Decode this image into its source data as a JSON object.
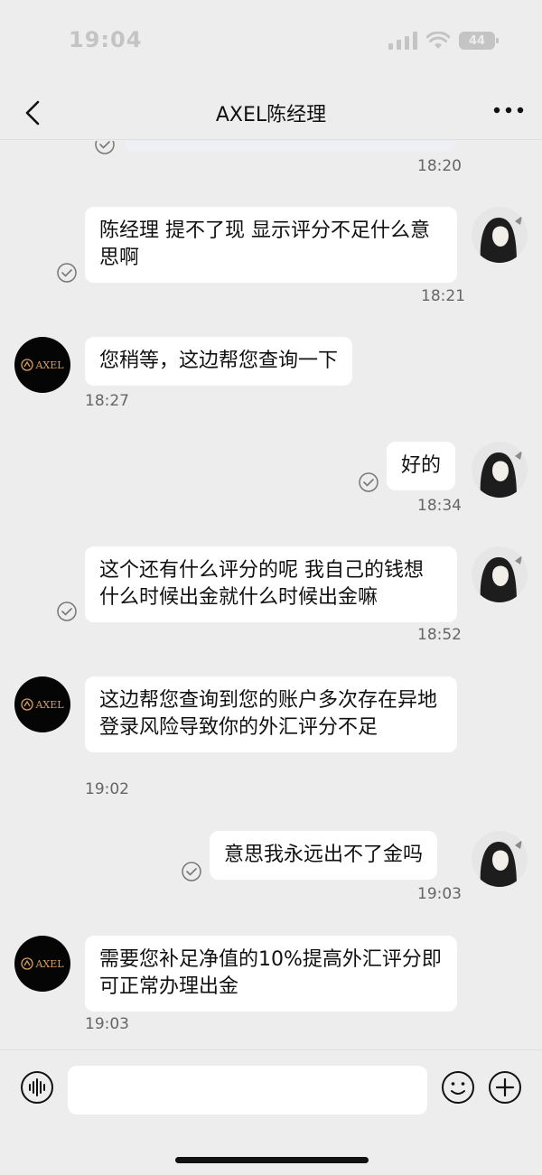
{
  "status_bar": {
    "time": "19:04",
    "battery": "44"
  },
  "header": {
    "title": "AXEL陈经理"
  },
  "avatars": {
    "agent_logo_text": "AXEL"
  },
  "messages": [
    {
      "time": "18:20"
    },
    {
      "text": "陈经理  提不了现  显示评分不足什么意思啊",
      "time": "18:21"
    },
    {
      "text": "您稍等，这边帮您查询一下",
      "time": "18:27"
    },
    {
      "text": "好的",
      "time": "18:34"
    },
    {
      "text": "这个还有什么评分的呢  我自己的钱想什么时候出金就什么时候出金嘛",
      "time": "18:52"
    },
    {
      "text": "这边帮您查询到您的账户多次存在异地登录风险导致你的外汇评分不足",
      "time": "19:02"
    },
    {
      "text": "意思我永远出不了金吗",
      "time": "19:03"
    },
    {
      "text": "需要您补足净值的10%提高外汇评分即可正常办理出金",
      "time": "19:03"
    }
  ],
  "input": {
    "value": ""
  },
  "colors": {
    "background": "#ededed",
    "bubble": "#ffffff",
    "agent_avatar_bg": "#050505",
    "logo_gold": "#d9a05a"
  },
  "icons": [
    "back-chevron-icon",
    "more-dots-icon",
    "read-check-icon",
    "voice-icon",
    "emoji-icon",
    "plus-icon",
    "signal-icon",
    "wifi-icon",
    "battery-icon"
  ]
}
